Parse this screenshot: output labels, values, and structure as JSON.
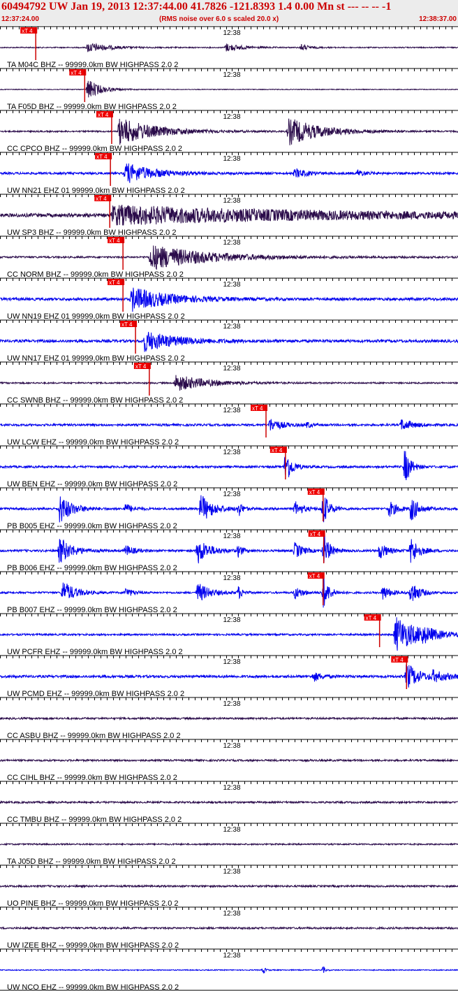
{
  "header": {
    "title": "60494792 UW Jan 19, 2013 12:37:44.00   41.7826 -121.8393  1.4 0.00 Mn st --- -- --  -1",
    "start_time": "12:37:24.00",
    "noise_note": "(RMS noise over 6.0 s scaled 20.0 x)",
    "end_time": "12:38:37.00"
  },
  "colors": {
    "header_text": "#cc0000",
    "header_bg": "#ececec",
    "trace_dark": "#2a0b4a",
    "trace_blue": "#0000ee",
    "pick_box": "#ee0000",
    "pick_line": "#cc0000",
    "axis": "#000000"
  },
  "chart_data": {
    "type": "line",
    "x_range_seconds": [
      0,
      73
    ],
    "minute_mark": {
      "label": "12:38",
      "t": 36
    },
    "tick_interval_seconds": 1,
    "pick_label": "xT 4",
    "traces": [
      {
        "label": "TA M04C BHZ -- 99999.0km BW  HIGHPASS  2.0  2",
        "color": "dark",
        "pick_t": 5.7,
        "bursts": [
          {
            "t": 14,
            "amp": 0.55,
            "dur": 5
          },
          {
            "t": 36,
            "amp": 0.45,
            "dur": 4
          },
          {
            "t": 48,
            "amp": 0.35,
            "dur": 2
          }
        ],
        "noise": 0.06
      },
      {
        "label": "TA F05D BHZ -- 99999.0km BW  HIGHPASS  2.0  2",
        "color": "dark",
        "pick_t": 13.5,
        "bursts": [
          {
            "t": 14,
            "amp": 1.2,
            "dur": 3
          }
        ],
        "noise": 0.04
      },
      {
        "label": "CC CPCO BHZ -- 99999.0km BW  HIGHPASS  2.0  2",
        "color": "dark",
        "pick_t": 17.8,
        "bursts": [
          {
            "t": 19,
            "amp": 1.5,
            "dur": 9
          },
          {
            "t": 46,
            "amp": 1.5,
            "dur": 8
          }
        ],
        "noise": 0.08
      },
      {
        "label": "UW NN21 EHZ 01 99999.0km BW  HIGHPASS  2.0  2",
        "color": "blue",
        "pick_t": 17.6,
        "bursts": [
          {
            "t": 20,
            "amp": 1.1,
            "dur": 7
          },
          {
            "t": 47,
            "amp": 0.5,
            "dur": 3
          },
          {
            "t": 57,
            "amp": 0.35,
            "dur": 2
          }
        ],
        "noise": 0.12
      },
      {
        "label": "UW SP3 BHZ -- 99999.0km BW  HIGHPASS  2.0  2",
        "color": "dark",
        "pick_t": 17.5,
        "bursts": [
          {
            "t": 18,
            "amp": 1.0,
            "dur": 55
          }
        ],
        "noise": 0.2
      },
      {
        "label": "CC NORM BHZ -- 99999.0km BW  HIGHPASS  2.0  2",
        "color": "dark",
        "pick_t": 19.6,
        "bursts": [
          {
            "t": 24,
            "amp": 1.4,
            "dur": 14
          }
        ],
        "noise": 0.1
      },
      {
        "label": "UW NN19 EHZ 01 99999.0km BW  HIGHPASS  2.0  2",
        "color": "blue",
        "pick_t": 19.6,
        "bursts": [
          {
            "t": 21,
            "amp": 1.3,
            "dur": 9
          }
        ],
        "noise": 0.15
      },
      {
        "label": "UW NN17 EHZ 01 99999.0km BW  HIGHPASS  2.0  2",
        "color": "blue",
        "pick_t": 21.6,
        "bursts": [
          {
            "t": 23,
            "amp": 1.1,
            "dur": 8
          }
        ],
        "noise": 0.15
      },
      {
        "label": "CC SWNB BHZ -- 99999.0km BW  HIGHPASS  2.0  2",
        "color": "dark",
        "pick_t": 23.8,
        "bursts": [
          {
            "t": 28,
            "amp": 0.9,
            "dur": 8
          }
        ],
        "noise": 0.08
      },
      {
        "label": "UW LCW EHZ -- 99999.0km BW  HIGHPASS  2.0  2",
        "color": "blue",
        "pick_t": 42.4,
        "bursts": [
          {
            "t": 43,
            "amp": 0.7,
            "dur": 3
          },
          {
            "t": 49,
            "amp": 0.3,
            "dur": 1
          },
          {
            "t": 64,
            "amp": 0.6,
            "dur": 3
          }
        ],
        "noise": 0.12
      },
      {
        "label": "UW BEN EHZ -- 99999.0km BW  HIGHPASS  2.0  2",
        "color": "blue",
        "pick_t": 45.5,
        "bursts": [
          {
            "t": 45.5,
            "amp": 2.0,
            "dur": 1.5
          },
          {
            "t": 64.5,
            "amp": 2.0,
            "dur": 1.5
          }
        ],
        "noise": 0.12
      },
      {
        "label": "PB B005 EHZ -- 99999.0km BW  HIGHPASS  2.0  2",
        "color": "blue",
        "pick_t": 51.5,
        "bursts": [
          {
            "t": 9.5,
            "amp": 1.6,
            "dur": 3
          },
          {
            "t": 20,
            "amp": 0.5,
            "dur": 2
          },
          {
            "t": 32,
            "amp": 1.6,
            "dur": 3
          },
          {
            "t": 38,
            "amp": 0.8,
            "dur": 1
          },
          {
            "t": 47,
            "amp": 0.8,
            "dur": 2
          },
          {
            "t": 51.5,
            "amp": 1.8,
            "dur": 1.5
          },
          {
            "t": 62,
            "amp": 0.9,
            "dur": 2
          },
          {
            "t": 65.5,
            "amp": 1.4,
            "dur": 2
          }
        ],
        "noise": 0.12
      },
      {
        "label": "PB B006 EHZ -- 99999.0km BW  HIGHPASS  2.0  2",
        "color": "blue",
        "pick_t": 51.6,
        "bursts": [
          {
            "t": 9.5,
            "amp": 1.5,
            "dur": 3
          },
          {
            "t": 20,
            "amp": 0.6,
            "dur": 2
          },
          {
            "t": 31.5,
            "amp": 1.4,
            "dur": 3
          },
          {
            "t": 38,
            "amp": 0.7,
            "dur": 1
          },
          {
            "t": 47,
            "amp": 0.9,
            "dur": 2
          },
          {
            "t": 51.6,
            "amp": 1.9,
            "dur": 1.5
          },
          {
            "t": 60.5,
            "amp": 0.9,
            "dur": 2
          },
          {
            "t": 65.5,
            "amp": 1.5,
            "dur": 2
          }
        ],
        "noise": 0.12
      },
      {
        "label": "PB B007 EHZ -- 99999.0km BW  HIGHPASS  2.0  2",
        "color": "blue",
        "pick_t": 51.5,
        "bursts": [
          {
            "t": 10,
            "amp": 1.3,
            "dur": 3
          },
          {
            "t": 20,
            "amp": 0.5,
            "dur": 2
          },
          {
            "t": 31.5,
            "amp": 1.1,
            "dur": 3
          },
          {
            "t": 38,
            "amp": 0.7,
            "dur": 1
          },
          {
            "t": 47,
            "amp": 0.7,
            "dur": 2
          },
          {
            "t": 51.5,
            "amp": 1.8,
            "dur": 1.5
          },
          {
            "t": 61,
            "amp": 0.8,
            "dur": 2
          },
          {
            "t": 65.5,
            "amp": 1.4,
            "dur": 2
          }
        ],
        "noise": 0.1
      },
      {
        "label": "UW PCFR EHZ -- 99999.0km BW  HIGHPASS  2.0  2",
        "color": "blue",
        "pick_t": 60.5,
        "bursts": [
          {
            "t": 63,
            "amp": 2.0,
            "dur": 6
          },
          {
            "t": 67,
            "amp": 0.5,
            "dur": 3
          }
        ],
        "noise": 0.1
      },
      {
        "label": "UW PCMD EHZ -- 99999.0km BW  HIGHPASS  2.0  2",
        "color": "blue",
        "pick_t": 64.8,
        "bursts": [
          {
            "t": 50,
            "amp": 0.5,
            "dur": 2
          },
          {
            "t": 64.8,
            "amp": 1.5,
            "dur": 3
          },
          {
            "t": 69,
            "amp": 0.5,
            "dur": 4
          }
        ],
        "noise": 0.14
      },
      {
        "label": "CC ASBU BHZ -- 99999.0km BW  HIGHPASS  2.0  2",
        "color": "dark",
        "pick_t": null,
        "bursts": [],
        "noise": 0.1
      },
      {
        "label": "CC CIHL BHZ -- 99999.0km BW  HIGHPASS  2.0  2",
        "color": "dark",
        "pick_t": null,
        "bursts": [],
        "noise": 0.1
      },
      {
        "label": "CC TMBU BHZ -- 99999.0km BW  HIGHPASS  2.0  2",
        "color": "dark",
        "pick_t": null,
        "bursts": [],
        "noise": 0.1
      },
      {
        "label": "TA J05D BHZ -- 99999.0km BW  HIGHPASS  2.0  2",
        "color": "dark",
        "pick_t": null,
        "bursts": [],
        "noise": 0.08
      },
      {
        "label": "UO PINE BHZ -- 99999.0km BW  HIGHPASS  2.0  2",
        "color": "dark",
        "pick_t": null,
        "bursts": [],
        "noise": 0.1
      },
      {
        "label": "UW IZEE BHZ -- 99999.0km BW  HIGHPASS  2.0  2",
        "color": "dark",
        "pick_t": null,
        "bursts": [],
        "noise": 0.1
      },
      {
        "label": "UW NCO EHZ -- 99999.0km BW  HIGHPASS  2.0  2",
        "color": "blue",
        "pick_t": null,
        "bursts": [
          {
            "t": 42,
            "amp": 0.4,
            "dur": 0.5
          },
          {
            "t": 51.5,
            "amp": 0.4,
            "dur": 0.5
          }
        ],
        "noise": 0.05
      }
    ]
  }
}
